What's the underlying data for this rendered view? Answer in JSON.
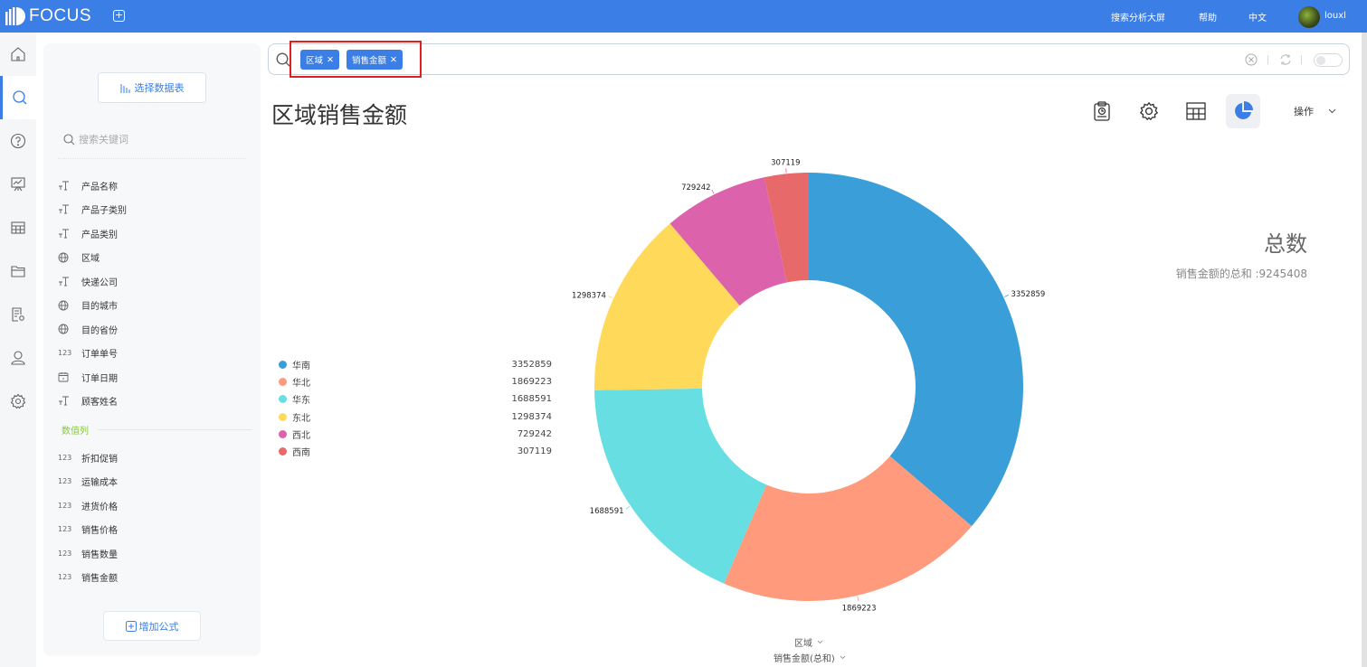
{
  "topbar": {
    "app_name": "FOCUS",
    "new_tab_icon": "plus-square-icon",
    "nav": [
      "搜索分析大屏",
      "帮助",
      "中文"
    ],
    "username": "louxl"
  },
  "rail": [
    {
      "icon": "home-icon"
    },
    {
      "icon": "search-icon",
      "active": true
    },
    {
      "icon": "help-icon"
    },
    {
      "icon": "dashboard-icon"
    },
    {
      "icon": "table-icon"
    },
    {
      "icon": "folder-icon"
    },
    {
      "icon": "doc-settings-icon"
    },
    {
      "icon": "user-icon"
    },
    {
      "icon": "gear-icon"
    }
  ],
  "panel": {
    "select_table_label": "选择数据表",
    "keyword_placeholder": "搜索关键词",
    "dimension_fields": [
      {
        "type": "text",
        "label": "产品名称"
      },
      {
        "type": "text",
        "label": "产品子类别"
      },
      {
        "type": "text",
        "label": "产品类别"
      },
      {
        "type": "geo",
        "label": "区域"
      },
      {
        "type": "text",
        "label": "快递公司"
      },
      {
        "type": "geo",
        "label": "目的城市"
      },
      {
        "type": "geo",
        "label": "目的省份"
      },
      {
        "type": "number",
        "label": "订单单号"
      },
      {
        "type": "date",
        "label": "订单日期"
      },
      {
        "type": "text",
        "label": "顾客姓名"
      }
    ],
    "measure_section_label": "数值列",
    "measure_fields": [
      {
        "type": "number",
        "label": "折扣促销"
      },
      {
        "type": "number",
        "label": "运输成本"
      },
      {
        "type": "number",
        "label": "进货价格"
      },
      {
        "type": "number",
        "label": "销售价格"
      },
      {
        "type": "number",
        "label": "销售数量"
      },
      {
        "type": "number",
        "label": "销售金额"
      }
    ],
    "number_icon_text": "123",
    "add_formula_label": "增加公式"
  },
  "search": {
    "tokens": [
      "区域",
      "销售金额"
    ],
    "clear_icon": "clear-circle-icon",
    "refresh_icon": "refresh-icon",
    "toggle_on": false
  },
  "main": {
    "title": "区域销售金额",
    "tools": [
      "clipboard-chart-icon",
      "gear-icon",
      "table-view-icon",
      "pie-chart-icon"
    ],
    "active_tool": "pie-chart-icon",
    "ops_label": "操作",
    "total_title": "总数",
    "total_label": "销售金额的总和 :9245408"
  },
  "chart_selectors": {
    "dimension": "区域",
    "measure": "销售金额(总和)"
  },
  "chart_data": {
    "type": "pie",
    "variant": "donut",
    "title": "区域销售金额",
    "categories": [
      "华南",
      "华北",
      "华东",
      "东北",
      "西北",
      "西南"
    ],
    "values": [
      3352859,
      1869223,
      1688591,
      1298374,
      729242,
      307119
    ],
    "colors": [
      "#3a9fd9",
      "#ff9b7c",
      "#66dee2",
      "#ffd95a",
      "#dc62ac",
      "#e8696a"
    ],
    "legend_position": "left",
    "data_labels": true,
    "total": 9245408
  }
}
